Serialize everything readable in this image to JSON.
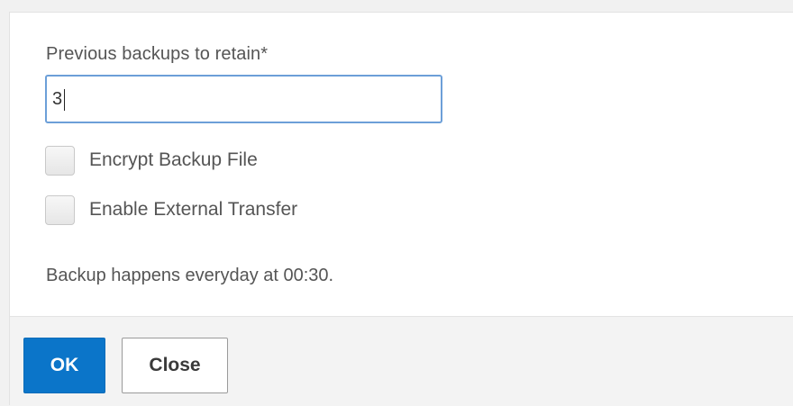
{
  "form": {
    "retain_label": "Previous backups to retain*",
    "retain_value": "3",
    "encrypt_label": "Encrypt Backup File",
    "encrypt_checked": false,
    "external_label": "Enable External Transfer",
    "external_checked": false,
    "schedule_info": "Backup happens everyday at 00:30."
  },
  "footer": {
    "ok_label": "OK",
    "close_label": "Close"
  },
  "colors": {
    "primary": "#0b75c9",
    "input_focus_border": "#6c9fd8",
    "footer_bg": "#f3f3f3"
  }
}
